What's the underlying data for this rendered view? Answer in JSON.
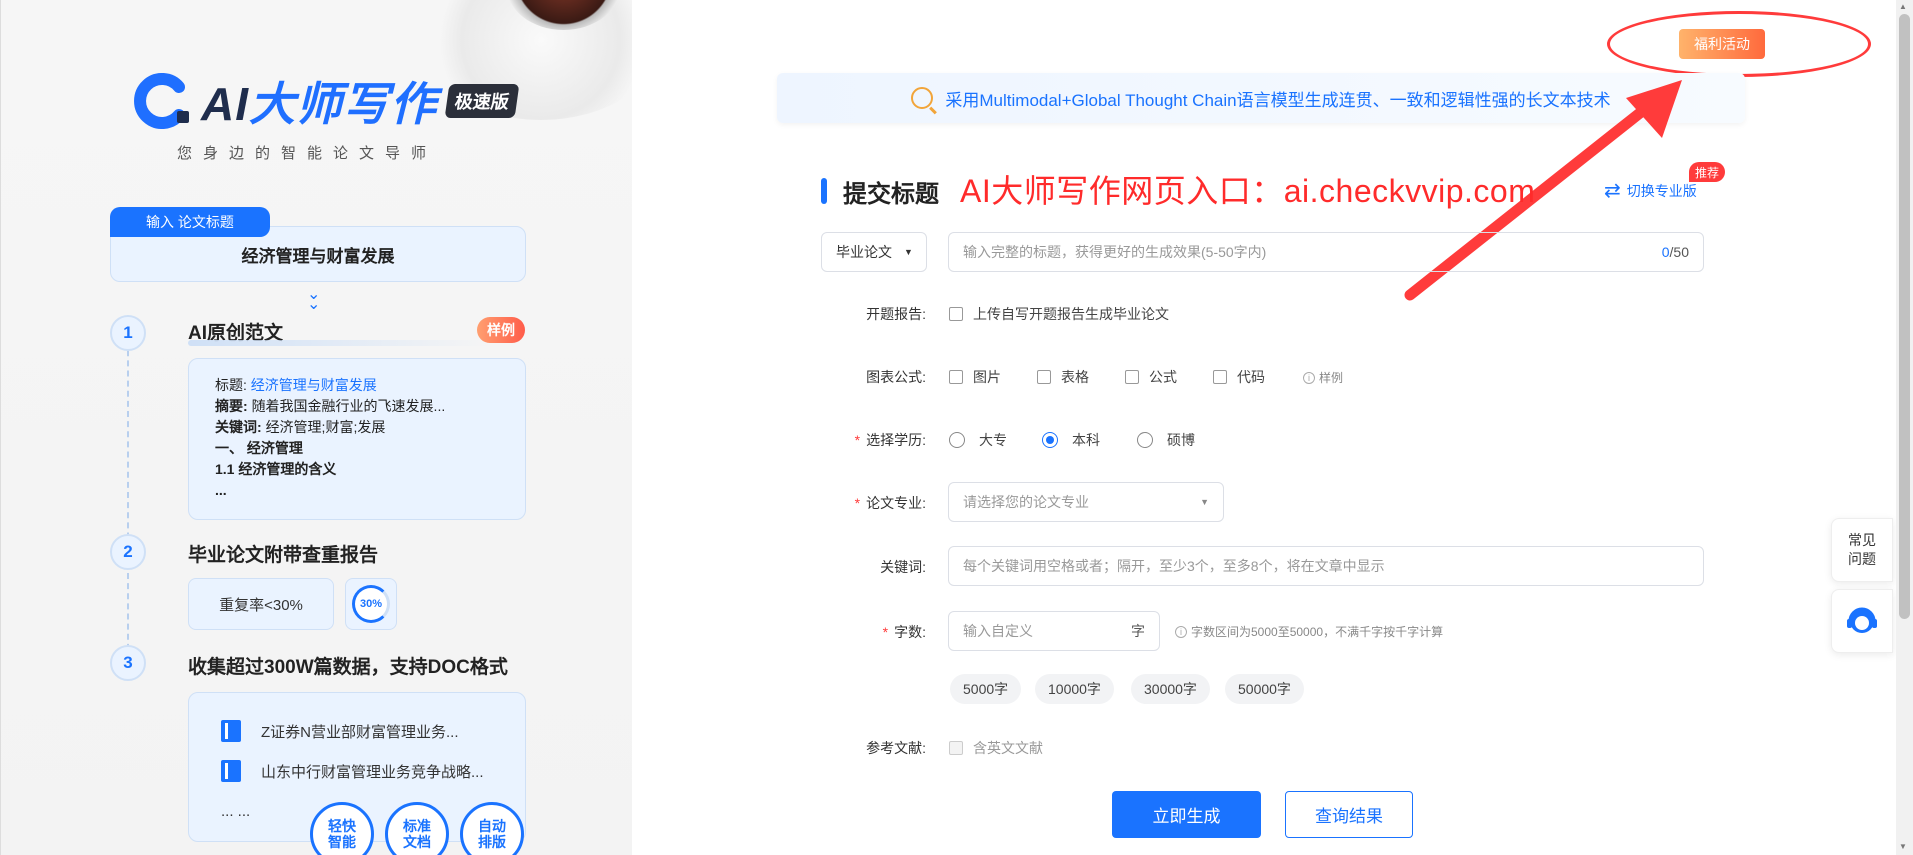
{
  "left": {
    "logo": {
      "prefix": "AI",
      "title": "大师写作",
      "badge": "极速版"
    },
    "slogan": "您身边的智能论文导师",
    "input": {
      "tab": "输入 论文标题",
      "value": "经济管理与财富发展"
    },
    "steps": [
      {
        "num": "1",
        "title": "AI原创范文",
        "badge": "样例"
      },
      {
        "num": "2",
        "title": "毕业论文附带查重报告"
      },
      {
        "num": "3",
        "title": "收集超过300W篇数据，支持DOC格式"
      }
    ],
    "sample": {
      "title_label": "标题:",
      "title_value": "经济管理与财富发展",
      "abstract_label": "摘要:",
      "abstract_value": "随着我国金融行业的飞速发展...",
      "keywords_label": "关键词:",
      "keywords_value": "经济管理;财富;发展",
      "line1": "一、 经济管理",
      "line2": "1.1 经济管理的含义",
      "line3": "..."
    },
    "rate": {
      "label": "重复率<30%",
      "ring": "30%"
    },
    "docs": [
      "Z证券N营业部财富管理业务...",
      "山东中行财富管理业务竞争战略...",
      "... ..."
    ],
    "features": [
      "轻快\n智能",
      "标准\n文档",
      "自动\n排版"
    ]
  },
  "promo": {
    "label": "福利活动"
  },
  "banner": {
    "text": "采用Multimodal+Global Thought Chain语言模型生成连贯、一致和逻辑性强的长文本技术"
  },
  "form": {
    "section_title": "提交标题",
    "overlay": "AI大师写作网页入口：ai.checkvvip.com",
    "switch_label": "切换专业版",
    "switch_badge": "推荐",
    "type_select": "毕业论文",
    "title_placeholder": "输入完整的标题，获得更好的生成效果(5-50字内)",
    "title_count_current": "0",
    "title_count_max": "/50",
    "proposal_label": "开题报告:",
    "proposal_option": "上传自写开题报告生成毕业论文",
    "chart_label": "图表公式:",
    "chart_options": [
      "图片",
      "表格",
      "公式",
      "代码"
    ],
    "chart_hint": "样例",
    "degree_label": "选择学历:",
    "degree_options": [
      "大专",
      "本科",
      "硕博"
    ],
    "degree_selected": "本科",
    "major_label": "论文专业:",
    "major_placeholder": "请选择您的论文专业",
    "keywords_label": "关键词:",
    "keywords_placeholder": "每个关键词用空格或者；隔开，至少3个，至多8个，将在文章中显示",
    "words_label": "字数:",
    "words_placeholder": "输入自定义",
    "words_suffix": "字",
    "words_hint": "字数区间为5000至50000，不满千字按千字计算",
    "word_chips": [
      "5000字",
      "10000字",
      "30000字",
      "50000字"
    ],
    "refs_label": "参考文献:",
    "refs_option": "含英文文献",
    "generate": "立即生成",
    "query": "查询结果"
  },
  "side": {
    "faq": "常见\n问题"
  },
  "colors": {
    "accent": "#1a73ff",
    "annotation": "#ff2b2b",
    "promo": "#ff6a3d"
  }
}
